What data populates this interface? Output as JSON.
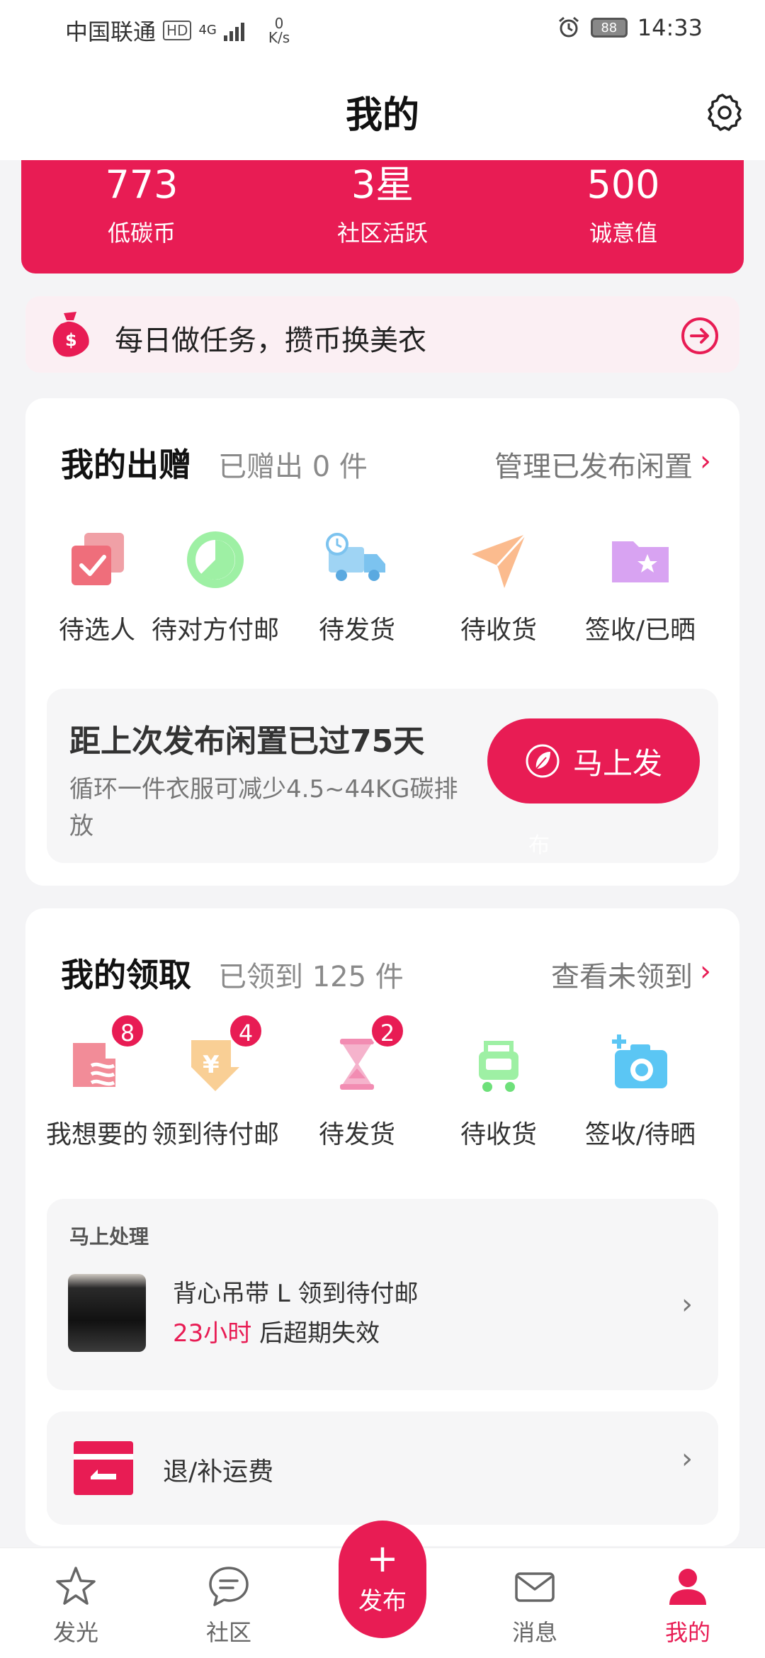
{
  "status_bar": {
    "carrier": "中国联通",
    "hd": "HD",
    "network": "4G",
    "speed_value": "0",
    "speed_unit": "K/s",
    "battery": "88",
    "time": "14:33"
  },
  "header": {
    "title": "我的"
  },
  "stats": [
    {
      "value": "773",
      "label": "低碳币"
    },
    {
      "value": "3星",
      "label": "社区活跃"
    },
    {
      "value": "500",
      "label": "诚意值"
    }
  ],
  "banner": {
    "text": "每日做任务，攒币换美衣"
  },
  "give": {
    "title": "我的出赠",
    "subtitle": "已赠出 0 件",
    "link": "管理已发布闲置",
    "chevron": "›",
    "items": [
      {
        "label": "待选人"
      },
      {
        "label": "待对方付邮"
      },
      {
        "label": "待发货"
      },
      {
        "label": "待收货"
      },
      {
        "label": "签收/已晒"
      }
    ],
    "promo": {
      "title": "距上次发布闲置已过75天",
      "desc": "循环一件衣服可减少4.5~44KG碳排放",
      "button": "马上发",
      "ghost": "布"
    }
  },
  "receive": {
    "title": "我的领取",
    "subtitle": "已领到 125 件",
    "link": "查看未领到",
    "chevron": "›",
    "items": [
      {
        "label": "我想要的",
        "badge": "8"
      },
      {
        "label": "领到待付邮",
        "badge": "4"
      },
      {
        "label": "待发货",
        "badge": "2"
      },
      {
        "label": "待收货"
      },
      {
        "label": "签收/待晒"
      }
    ],
    "handle": {
      "title": "马上处理",
      "item_name": "背心吊带 L 领到待付邮",
      "time_highlight": "23小时",
      "time_rest": " 后超期失效",
      "chevron": "›"
    },
    "refund": {
      "label": "退/补运费",
      "chevron": "›"
    }
  },
  "nav": {
    "items": [
      {
        "label": "发光"
      },
      {
        "label": "社区"
      },
      {
        "label": "消息"
      },
      {
        "label": "我的"
      }
    ],
    "publish_plus": "+",
    "publish_label": "发布",
    "active_color": "#e81c54"
  },
  "colors": {
    "accent": "#e81c54"
  }
}
